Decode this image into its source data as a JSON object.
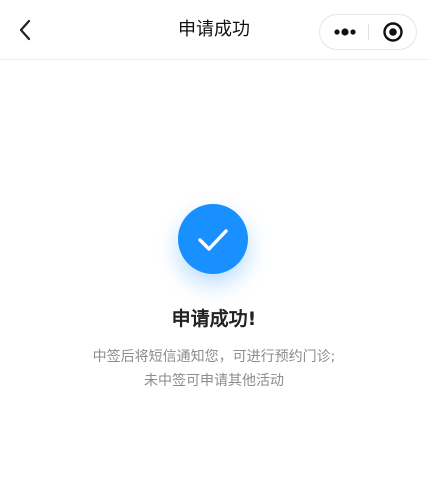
{
  "navbar": {
    "title": "申请成功",
    "back_icon": "chevron-left-icon",
    "more_icon": "more-dots-icon",
    "close_icon": "target-circle-icon"
  },
  "result": {
    "icon": "check-circle-icon",
    "title": "申请成功!",
    "description_lines": [
      "中签后将短信通知您，可进行预约门诊;",
      "未中签可申请其他活动"
    ]
  },
  "colors": {
    "accent": "#1890ff",
    "title_text": "#222222",
    "desc_text": "#8c8c8c"
  }
}
